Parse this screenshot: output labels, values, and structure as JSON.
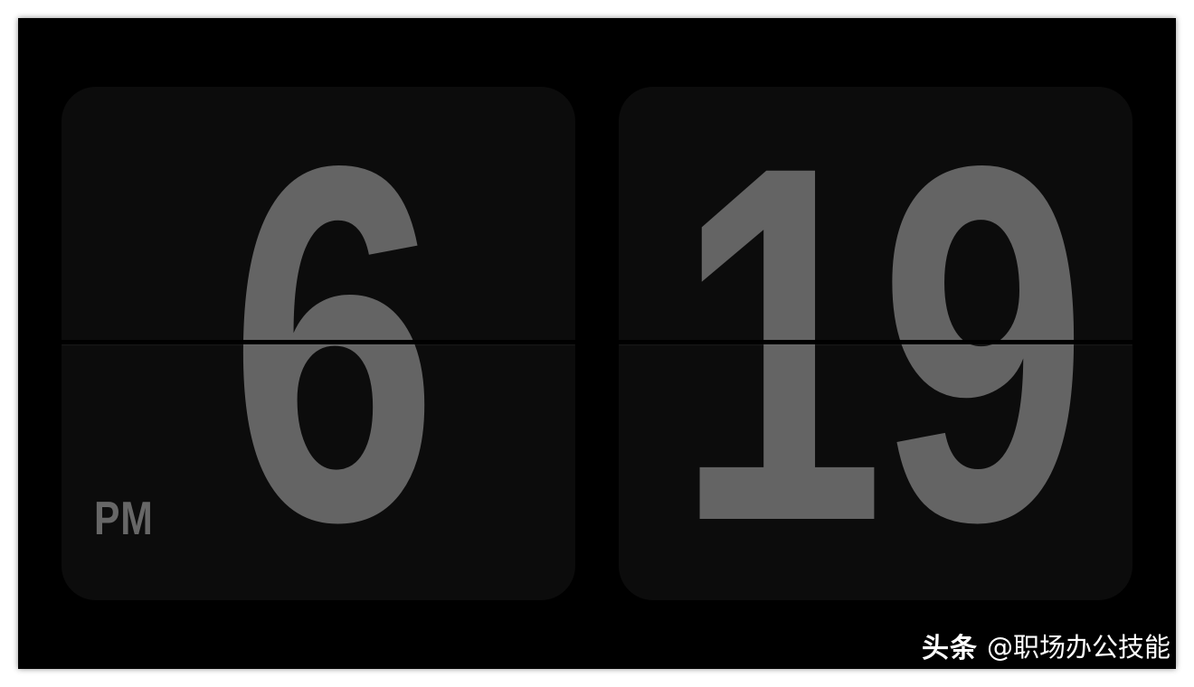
{
  "clock": {
    "hours": "6",
    "minutes": "19",
    "meridiem": "PM"
  },
  "watermark": {
    "brand": "头条",
    "handle": "@职场办公技能"
  },
  "colors": {
    "background": "#000000",
    "card": "#0c0c0c",
    "digit": "#646464"
  }
}
